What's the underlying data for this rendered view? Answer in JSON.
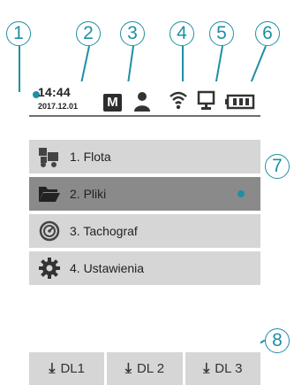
{
  "status": {
    "time": "14:44",
    "date": "2017.12.01",
    "mode_badge": "M"
  },
  "callouts": [
    "1",
    "2",
    "3",
    "4",
    "5",
    "6",
    "7",
    "8"
  ],
  "menu": [
    {
      "label": "1. Flota",
      "icon": "truck-icon",
      "selected": false
    },
    {
      "label": "2. Pliki",
      "icon": "folder-icon",
      "selected": true
    },
    {
      "label": "3. Tachograf",
      "icon": "tachograph-icon",
      "selected": false
    },
    {
      "label": "4. Ustawienia",
      "icon": "gear-icon",
      "selected": false
    }
  ],
  "footer": [
    {
      "label": "DL1"
    },
    {
      "label": "DL 2"
    },
    {
      "label": "DL 3"
    }
  ],
  "colors": {
    "callout": "#1e8fa5",
    "menu_bg": "#d6d6d6",
    "menu_selected_bg": "#8a8a8a"
  }
}
